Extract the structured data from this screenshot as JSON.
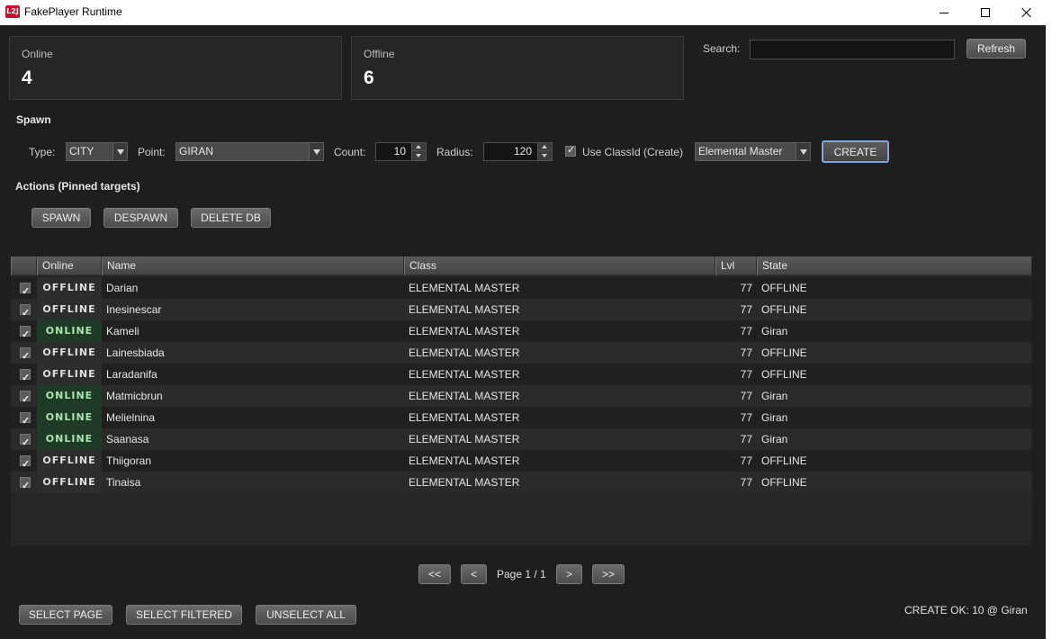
{
  "window": {
    "app_icon_text": "L2J",
    "title": "FakePlayer Runtime",
    "minimize_icon": "minimize-icon",
    "maximize_icon": "maximize-icon",
    "close_icon": "close-icon"
  },
  "stats": {
    "online_label": "Online",
    "online_value": "4",
    "offline_label": "Offline",
    "offline_value": "6"
  },
  "search": {
    "label": "Search:",
    "value": "",
    "refresh_label": "Refresh"
  },
  "spawn": {
    "section_title": "Spawn",
    "type_label": "Type:",
    "type_value": "CITY",
    "point_label": "Point:",
    "point_value": "GIRAN",
    "count_label": "Count:",
    "count_value": "10",
    "radius_label": "Radius:",
    "radius_value": "120",
    "use_classid_label": "Use ClassId (Create)",
    "use_classid_checked": true,
    "class_value": "Elemental Master",
    "create_label": "CREATE"
  },
  "actions": {
    "section_title": "Actions (Pinned targets)",
    "spawn_label": "SPAWN",
    "despawn_label": "DESPAWN",
    "delete_db_label": "DELETE DB"
  },
  "table": {
    "columns": [
      "",
      "Online",
      "Name",
      "Class",
      "Lvl",
      "State"
    ],
    "rows": [
      {
        "checked": true,
        "online": "OFFLINE",
        "is_online": false,
        "name": "Darian",
        "class": "ELEMENTAL MASTER",
        "lvl": "77",
        "state": "OFFLINE"
      },
      {
        "checked": true,
        "online": "OFFLINE",
        "is_online": false,
        "name": "Inesinescar",
        "class": "ELEMENTAL MASTER",
        "lvl": "77",
        "state": "OFFLINE"
      },
      {
        "checked": true,
        "online": "ONLINE",
        "is_online": true,
        "name": "Kameli",
        "class": "ELEMENTAL MASTER",
        "lvl": "77",
        "state": "Giran"
      },
      {
        "checked": true,
        "online": "OFFLINE",
        "is_online": false,
        "name": "Lainesbiada",
        "class": "ELEMENTAL MASTER",
        "lvl": "77",
        "state": "OFFLINE"
      },
      {
        "checked": true,
        "online": "OFFLINE",
        "is_online": false,
        "name": "Laradanifa",
        "class": "ELEMENTAL MASTER",
        "lvl": "77",
        "state": "OFFLINE"
      },
      {
        "checked": true,
        "online": "ONLINE",
        "is_online": true,
        "name": "Matmicbrun",
        "class": "ELEMENTAL MASTER",
        "lvl": "77",
        "state": "Giran"
      },
      {
        "checked": true,
        "online": "ONLINE",
        "is_online": true,
        "name": "Melielnina",
        "class": "ELEMENTAL MASTER",
        "lvl": "77",
        "state": "Giran"
      },
      {
        "checked": true,
        "online": "ONLINE",
        "is_online": true,
        "name": "Saanasa",
        "class": "ELEMENTAL MASTER",
        "lvl": "77",
        "state": "Giran"
      },
      {
        "checked": true,
        "online": "OFFLINE",
        "is_online": false,
        "name": "Thiigoran",
        "class": "ELEMENTAL MASTER",
        "lvl": "77",
        "state": "OFFLINE"
      },
      {
        "checked": true,
        "online": "OFFLINE",
        "is_online": false,
        "name": "Tinaisa",
        "class": "ELEMENTAL MASTER",
        "lvl": "77",
        "state": "OFFLINE"
      }
    ]
  },
  "pager": {
    "first_label": "<<",
    "prev_label": "<",
    "page_text": "Page 1 / 1",
    "next_label": ">",
    "last_label": ">>"
  },
  "footer": {
    "select_page_label": "SELECT PAGE",
    "select_filtered_label": "SELECT FILTERED",
    "unselect_all_label": "UNSELECT ALL",
    "status_message": "CREATE OK: 10 @ Giran"
  },
  "colors": {
    "background": "#1e1e1e",
    "online_badge_bg": "#1f3a26",
    "online_badge_fg": "#a8e6b0",
    "offline_badge_bg": "#2d2d2d",
    "focus_border": "#7ea6d8"
  }
}
